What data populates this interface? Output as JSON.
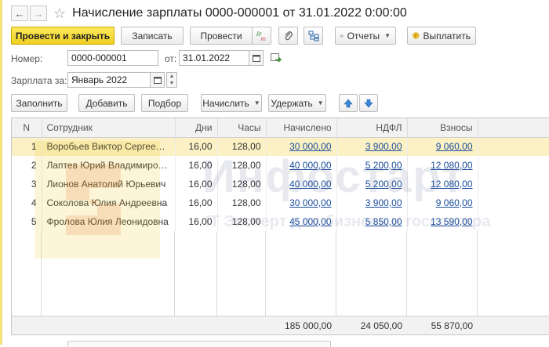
{
  "window": {
    "title": "Начисление зарплаты 0000-000001 от 31.01.2022 0:00:00"
  },
  "toolbar": {
    "post_close": "Провести и закрыть",
    "write": "Записать",
    "post": "Провести",
    "reports": "Отчеты",
    "pay": "Выплатить"
  },
  "form": {
    "number_label": "Номер:",
    "number_value": "0000-000001",
    "date_label": "от:",
    "date_value": "31.01.2022",
    "salary_label": "Зарплата за:",
    "salary_value": "Январь 2022"
  },
  "table_toolbar": {
    "fill": "Заполнить",
    "add": "Добавить",
    "select": "Подбор",
    "accrue": "Начислить",
    "deduct": "Удержать"
  },
  "table": {
    "headers": [
      "N",
      "Сотрудник",
      "Дни",
      "Часы",
      "Начислено",
      "НДФЛ",
      "Взносы"
    ],
    "rows": [
      {
        "n": "1",
        "employee": "Воробьев Виктор Сергеевич",
        "days": "16,00",
        "hours": "128,00",
        "accrued": "30 000,00",
        "ndfl": "3 900,00",
        "contrib": "9 060,00"
      },
      {
        "n": "2",
        "employee": "Лаптев Юрий Владимиров...",
        "days": "16,00",
        "hours": "128,00",
        "accrued": "40 000,00",
        "ndfl": "5 200,00",
        "contrib": "12 080,00"
      },
      {
        "n": "3",
        "employee": "Лионов Анатолий Юрьевич",
        "days": "16,00",
        "hours": "128,00",
        "accrued": "40 000,00",
        "ndfl": "5 200,00",
        "contrib": "12 080,00"
      },
      {
        "n": "4",
        "employee": "Соколова Юлия Андреевна",
        "days": "16,00",
        "hours": "128,00",
        "accrued": "30 000,00",
        "ndfl": "3 900,00",
        "contrib": "9 060,00"
      },
      {
        "n": "5",
        "employee": "Фролова Юлия Леонидовна",
        "days": "16,00",
        "hours": "128,00",
        "accrued": "45 000,00",
        "ndfl": "5 850,00",
        "contrib": "13 590,00"
      }
    ],
    "totals": {
      "accrued": "185 000,00",
      "ndfl": "24 050,00",
      "contrib": "55 870,00"
    }
  },
  "watermark": {
    "brand": "Инфостарт",
    "tagline": "IT Эксперт для бизнеса и госсектора"
  },
  "colors": {
    "primary_button": "#f0cf20",
    "selected_row": "#fbf1c4",
    "link": "#1a4d9c"
  }
}
